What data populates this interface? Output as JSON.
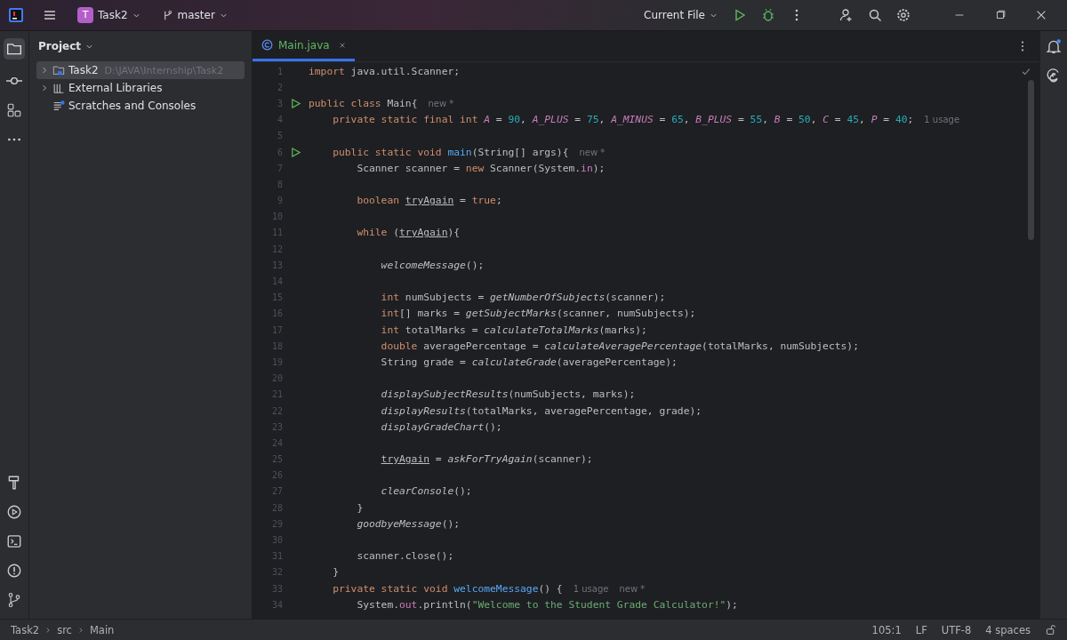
{
  "titlebar": {
    "project_initial": "T",
    "project": "Task2",
    "branch": "master",
    "run_config": "Current File"
  },
  "project_panel": {
    "title": "Project",
    "items": [
      {
        "label": "Task2",
        "path": "D:\\JAVA\\Internship\\Task2",
        "expandable": true,
        "expanded": false,
        "selected": true,
        "kind": "module"
      },
      {
        "label": "External Libraries",
        "expandable": true,
        "expanded": false,
        "selected": false,
        "kind": "library"
      },
      {
        "label": "Scratches and Consoles",
        "expandable": false,
        "selected": false,
        "kind": "scratch"
      }
    ]
  },
  "tabs": [
    {
      "label": "Main.java",
      "selected": true
    }
  ],
  "code": [
    {
      "n": "1",
      "run": false,
      "tokens": [
        {
          "kind": "kw",
          "text": "import "
        },
        {
          "kind": "plain",
          "text": "java.util.Scanner;"
        }
      ]
    },
    {
      "n": "2",
      "run": false
    },
    {
      "n": "3",
      "run": true,
      "tokens": [
        {
          "kind": "kw",
          "text": "public class "
        },
        {
          "kind": "plain",
          "text": "Main{"
        },
        {
          "kind": "hint",
          "text": "new *"
        }
      ],
      "children": [
        {
          "n": "4",
          "run": false,
          "tokens": [
            {
              "kind": "kw",
              "text": "private static final int "
            },
            {
              "kind": "const",
              "text": "A"
            },
            {
              "kind": "plain",
              "text": " = "
            },
            {
              "kind": "num",
              "text": "90"
            },
            {
              "kind": "plain",
              "text": ", "
            },
            {
              "kind": "const",
              "text": "A_PLUS"
            },
            {
              "kind": "plain",
              "text": " = "
            },
            {
              "kind": "num",
              "text": "75"
            },
            {
              "kind": "plain",
              "text": ", "
            },
            {
              "kind": "const",
              "text": "A_MINUS"
            },
            {
              "kind": "plain",
              "text": " = "
            },
            {
              "kind": "num",
              "text": "65"
            },
            {
              "kind": "plain",
              "text": ", "
            },
            {
              "kind": "const",
              "text": "B_PLUS"
            },
            {
              "kind": "plain",
              "text": " = "
            },
            {
              "kind": "num",
              "text": "55"
            },
            {
              "kind": "plain",
              "text": ", "
            },
            {
              "kind": "const",
              "text": "B"
            },
            {
              "kind": "plain",
              "text": " = "
            },
            {
              "kind": "num",
              "text": "50"
            },
            {
              "kind": "plain",
              "text": ", "
            },
            {
              "kind": "const",
              "text": "C"
            },
            {
              "kind": "plain",
              "text": " = "
            },
            {
              "kind": "num",
              "text": "45"
            },
            {
              "kind": "plain",
              "text": ", "
            },
            {
              "kind": "const",
              "text": "P"
            },
            {
              "kind": "plain",
              "text": " = "
            },
            {
              "kind": "num",
              "text": "40"
            },
            {
              "kind": "plain",
              "text": ";"
            },
            {
              "kind": "hint",
              "text": "1 usage"
            }
          ]
        },
        {
          "n": "5",
          "run": false
        },
        {
          "n": "6",
          "run": true,
          "tokens": [
            {
              "kind": "kw",
              "text": "public static void "
            },
            {
              "kind": "decl",
              "text": "main"
            },
            {
              "kind": "plain",
              "text": "(String[] args){"
            },
            {
              "kind": "hint",
              "text": "new *"
            }
          ],
          "children": [
            {
              "n": "7",
              "run": false,
              "tokens": [
                {
                  "kind": "plain",
                  "text": "Scanner scanner = "
                },
                {
                  "kind": "kw",
                  "text": "new "
                },
                {
                  "kind": "plain",
                  "text": "Scanner(System."
                },
                {
                  "kind": "field",
                  "text": "in"
                },
                {
                  "kind": "plain",
                  "text": ");"
                }
              ]
            },
            {
              "n": "8",
              "run": false
            },
            {
              "n": "9",
              "run": false,
              "tokens": [
                {
                  "kind": "kw",
                  "text": "boolean "
                },
                {
                  "kind": "var",
                  "text": "tryAgain"
                },
                {
                  "kind": "plain",
                  "text": " = "
                },
                {
                  "kind": "kw",
                  "text": "true"
                },
                {
                  "kind": "plain",
                  "text": ";"
                }
              ]
            },
            {
              "n": "10",
              "run": false
            },
            {
              "n": "11",
              "run": false,
              "tokens": [
                {
                  "kind": "kw",
                  "text": "while "
                },
                {
                  "kind": "plain",
                  "text": "("
                },
                {
                  "kind": "var",
                  "text": "tryAgain"
                },
                {
                  "kind": "plain",
                  "text": "){"
                }
              ],
              "children": [
                {
                  "n": "12",
                  "run": false
                },
                {
                  "n": "13",
                  "run": false,
                  "tokens": [
                    {
                      "kind": "call",
                      "text": "welcomeMessage"
                    },
                    {
                      "kind": "plain",
                      "text": "();"
                    }
                  ]
                },
                {
                  "n": "14",
                  "run": false
                },
                {
                  "n": "15",
                  "run": false,
                  "tokens": [
                    {
                      "kind": "kw",
                      "text": "int "
                    },
                    {
                      "kind": "plain",
                      "text": "numSubjects = "
                    },
                    {
                      "kind": "call",
                      "text": "getNumberOfSubjects"
                    },
                    {
                      "kind": "plain",
                      "text": "(scanner);"
                    }
                  ]
                },
                {
                  "n": "16",
                  "run": false,
                  "tokens": [
                    {
                      "kind": "kw",
                      "text": "int"
                    },
                    {
                      "kind": "plain",
                      "text": "[] marks = "
                    },
                    {
                      "kind": "call",
                      "text": "getSubjectMarks"
                    },
                    {
                      "kind": "plain",
                      "text": "(scanner, numSubjects);"
                    }
                  ]
                },
                {
                  "n": "17",
                  "run": false,
                  "tokens": [
                    {
                      "kind": "kw",
                      "text": "int "
                    },
                    {
                      "kind": "plain",
                      "text": "totalMarks = "
                    },
                    {
                      "kind": "call",
                      "text": "calculateTotalMarks"
                    },
                    {
                      "kind": "plain",
                      "text": "(marks);"
                    }
                  ]
                },
                {
                  "n": "18",
                  "run": false,
                  "tokens": [
                    {
                      "kind": "kw",
                      "text": "double "
                    },
                    {
                      "kind": "plain",
                      "text": "averagePercentage = "
                    },
                    {
                      "kind": "call",
                      "text": "calculateAveragePercentage"
                    },
                    {
                      "kind": "plain",
                      "text": "(totalMarks, numSubjects);"
                    }
                  ]
                },
                {
                  "n": "19",
                  "run": false,
                  "tokens": [
                    {
                      "kind": "plain",
                      "text": "String grade = "
                    },
                    {
                      "kind": "call",
                      "text": "calculateGrade"
                    },
                    {
                      "kind": "plain",
                      "text": "(averagePercentage);"
                    }
                  ]
                },
                {
                  "n": "20",
                  "run": false
                },
                {
                  "n": "21",
                  "run": false,
                  "tokens": [
                    {
                      "kind": "call",
                      "text": "displaySubjectResults"
                    },
                    {
                      "kind": "plain",
                      "text": "(numSubjects, marks);"
                    }
                  ]
                },
                {
                  "n": "22",
                  "run": false,
                  "tokens": [
                    {
                      "kind": "call",
                      "text": "displayResults"
                    },
                    {
                      "kind": "plain",
                      "text": "(totalMarks, averagePercentage, grade);"
                    }
                  ]
                },
                {
                  "n": "23",
                  "run": false,
                  "tokens": [
                    {
                      "kind": "call",
                      "text": "displayGradeChart"
                    },
                    {
                      "kind": "plain",
                      "text": "();"
                    }
                  ]
                },
                {
                  "n": "24",
                  "run": false
                },
                {
                  "n": "25",
                  "run": false,
                  "tokens": [
                    {
                      "kind": "var",
                      "text": "tryAgain"
                    },
                    {
                      "kind": "plain",
                      "text": " = "
                    },
                    {
                      "kind": "call",
                      "text": "askForTryAgain"
                    },
                    {
                      "kind": "plain",
                      "text": "(scanner);"
                    }
                  ]
                },
                {
                  "n": "26",
                  "run": false
                },
                {
                  "n": "27",
                  "run": false,
                  "tokens": [
                    {
                      "kind": "call",
                      "text": "clearConsole"
                    },
                    {
                      "kind": "plain",
                      "text": "();"
                    }
                  ]
                }
              ]
            },
            {
              "n": "28",
              "run": false,
              "tokens": [
                {
                  "kind": "plain",
                  "text": "}"
                }
              ]
            },
            {
              "n": "29",
              "run": false,
              "tokens": [
                {
                  "kind": "call",
                  "text": "goodbyeMessage"
                },
                {
                  "kind": "plain",
                  "text": "();"
                }
              ]
            },
            {
              "n": "30",
              "run": false
            },
            {
              "n": "31",
              "run": false,
              "tokens": [
                {
                  "kind": "plain",
                  "text": "scanner.close();"
                }
              ]
            }
          ]
        },
        {
          "n": "32",
          "run": false,
          "tokens": [
            {
              "kind": "plain",
              "text": "}"
            }
          ]
        },
        {
          "n": "33",
          "run": false,
          "tokens": [
            {
              "kind": "kw",
              "text": "private static void "
            },
            {
              "kind": "decl",
              "text": "welcomeMessage"
            },
            {
              "kind": "plain",
              "text": "() {"
            },
            {
              "kind": "hint",
              "text": "1 usage"
            },
            {
              "kind": "hint",
              "text": "new *"
            }
          ],
          "children": [
            {
              "n": "34",
              "run": false,
              "tokens": [
                {
                  "kind": "plain",
                  "text": "System."
                },
                {
                  "kind": "field",
                  "text": "out"
                },
                {
                  "kind": "plain",
                  "text": ".println("
                },
                {
                  "kind": "str",
                  "text": "\"Welcome to the Student Grade Calculator!\""
                },
                {
                  "kind": "plain",
                  "text": ");"
                }
              ]
            }
          ]
        }
      ]
    }
  ],
  "status_bar": {
    "breadcrumbs": [
      "Task2",
      "src",
      "Main"
    ],
    "position": "105:1",
    "line_ending": "LF",
    "encoding": "UTF-8",
    "indent": "4 spaces"
  }
}
